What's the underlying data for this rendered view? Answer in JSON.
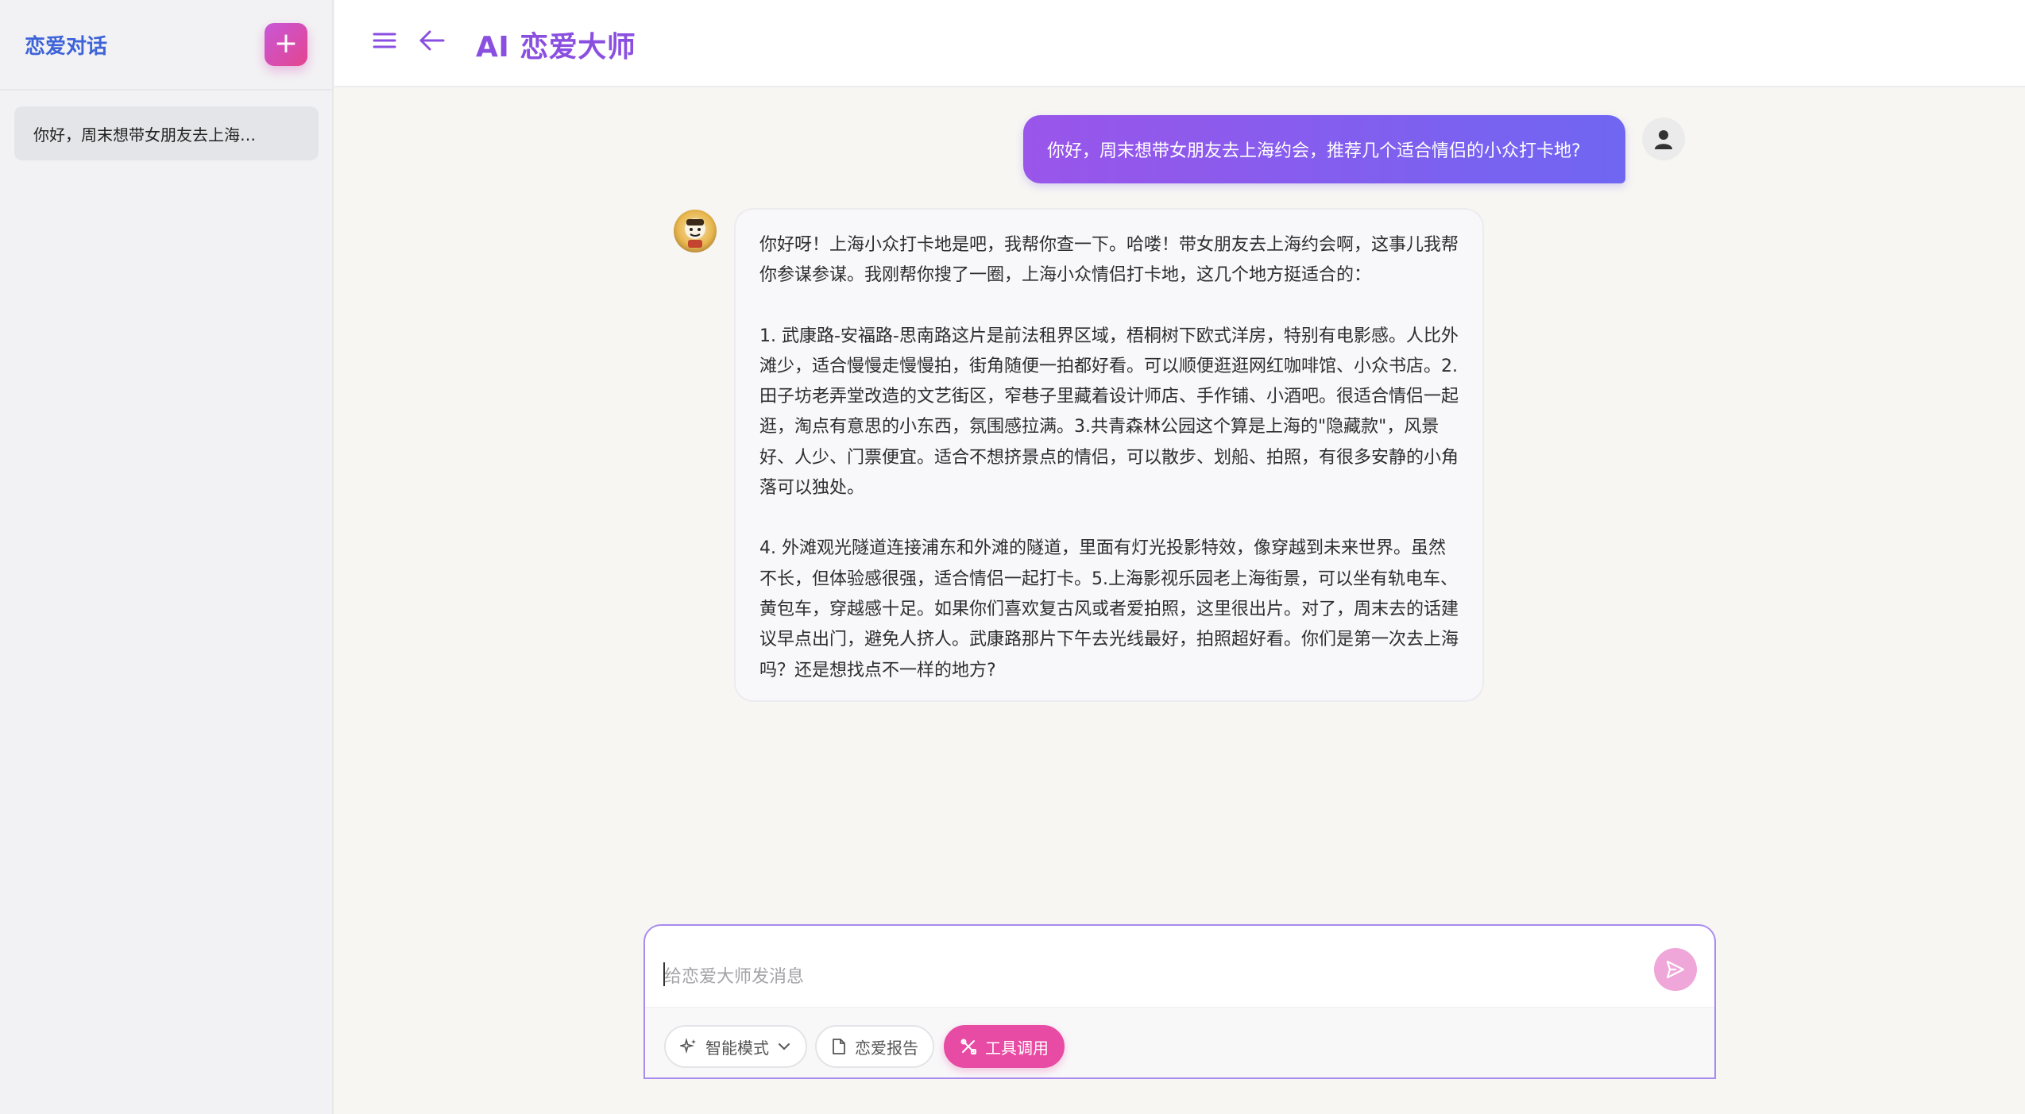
{
  "sidebar": {
    "title": "恋爱对话",
    "new_chat_icon": "plus-icon",
    "conversations": [
      {
        "label": "你好，周末想带女朋友去上海…"
      }
    ]
  },
  "header": {
    "menu_icon": "hamburger-menu-icon",
    "back_icon": "arrow-left-icon",
    "title": "AI 恋爱大师"
  },
  "messages": [
    {
      "role": "user",
      "text": "你好，周末想带女朋友去上海约会，推荐几个适合情侣的小众打卡地?"
    },
    {
      "role": "assistant",
      "paragraphs": [
        "你好呀！上海小众打卡地是吧，我帮你查一下。哈喽！带女朋友去上海约会啊，这事儿我帮你参谋参谋。我刚帮你搜了一圈，上海小众情侣打卡地，这几个地方挺适合的：",
        "1. 武康路-安福路-思南路这片是前法租界区域，梧桐树下欧式洋房，特别有电影感。人比外滩少，适合慢慢走慢慢拍，街角随便一拍都好看。可以顺便逛逛网红咖啡馆、小众书店。2.田子坊老弄堂改造的文艺街区，窄巷子里藏着设计师店、手作铺、小酒吧。很适合情侣一起逛，淘点有意思的小东西，氛围感拉满。3.共青森林公园这个算是上海的\"隐藏款\"，风景好、人少、门票便宜。适合不想挤景点的情侣，可以散步、划船、拍照，有很多安静的小角落可以独处。",
        "4. 外滩观光隧道连接浦东和外滩的隧道，里面有灯光投影特效，像穿越到未来世界。虽然不长，但体验感很强，适合情侣一起打卡。5.上海影视乐园老上海街景，可以坐有轨电车、黄包车，穿越感十足。如果你们喜欢复古风或者爱拍照，这里很出片。对了，周末去的话建议早点出门，避免人挤人。武康路那片下午去光线最好，拍照超好看。你们是第一次去上海吗？还是想找点不一样的地方?"
      ]
    }
  ],
  "composer": {
    "placeholder": "给恋爱大师发消息",
    "value": "",
    "send_icon": "send-icon",
    "tools": [
      {
        "label": "智能模式",
        "icon": "sparkle-icon",
        "dropdown": true,
        "active": false
      },
      {
        "label": "恋爱报告",
        "icon": "document-icon",
        "active": false
      },
      {
        "label": "工具调用",
        "icon": "tools-icon",
        "active": true
      }
    ]
  },
  "colors": {
    "accent_purple": "#8a4fe0",
    "sidebar_title_blue": "#3d63d8",
    "pink_active": "#e84ba3"
  }
}
